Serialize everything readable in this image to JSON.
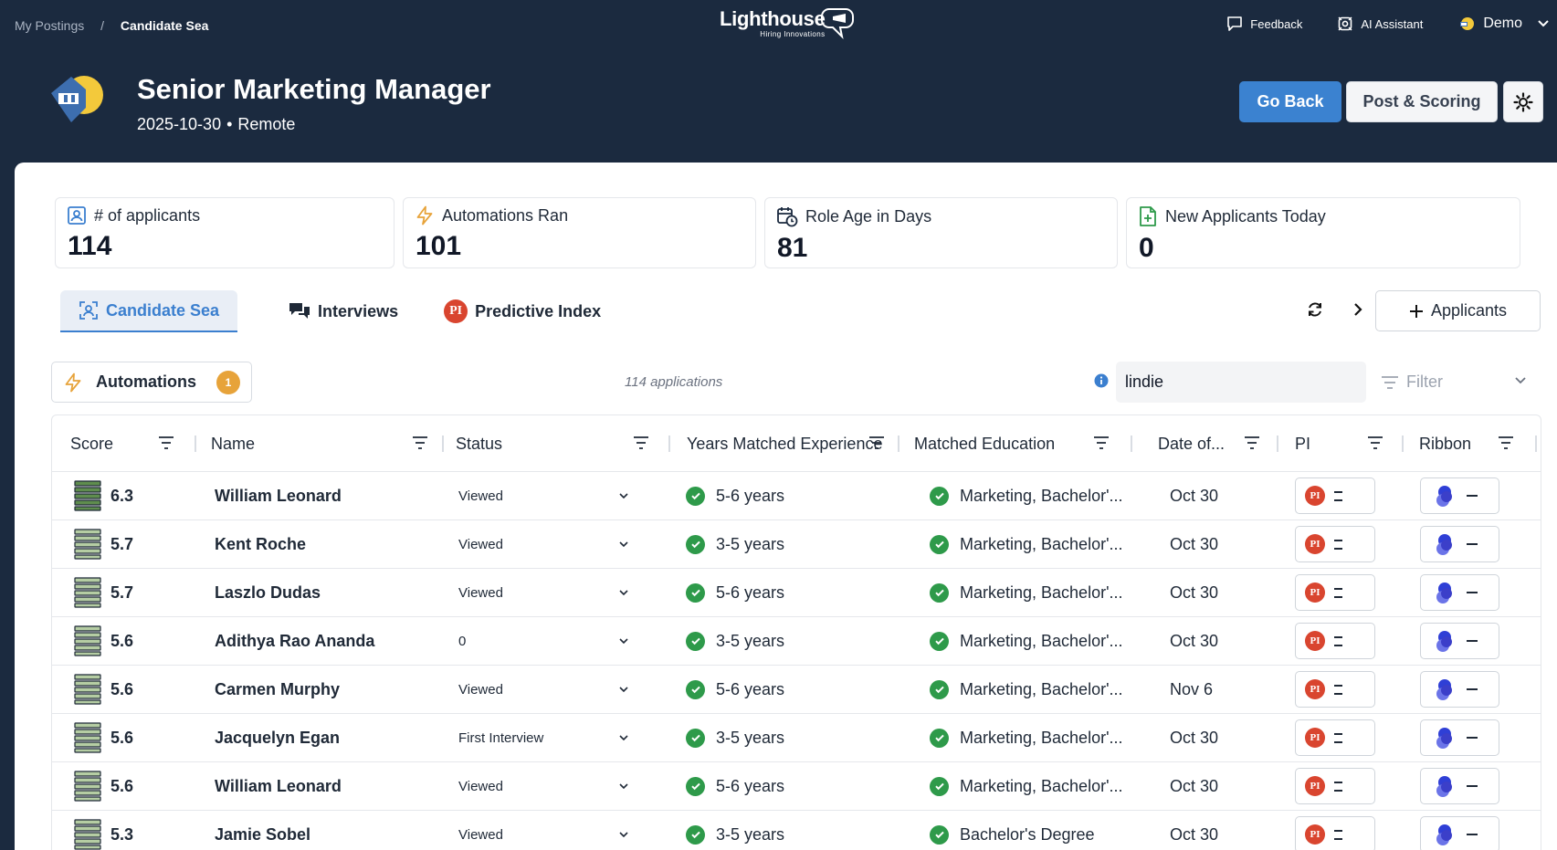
{
  "breadcrumb": {
    "root": "My Postings",
    "separator": "/",
    "current": "Candidate Sea"
  },
  "logo": {
    "word": "Lighthouse",
    "tagline": "Hiring Innovations"
  },
  "nav": {
    "feedback": "Feedback",
    "ai_assistant": "AI Assistant",
    "user": "Demo"
  },
  "job": {
    "title": "Senior Marketing Manager",
    "date": "2025-10-30",
    "location": "Remote"
  },
  "actions": {
    "go_back": "Go Back",
    "post_scoring": "Post & Scoring"
  },
  "stats": [
    {
      "label": "# of applicants",
      "value": "114",
      "icon": "user-card-icon"
    },
    {
      "label": "Automations Ran",
      "value": "101",
      "icon": "bolt-icon"
    },
    {
      "label": "Role Age in Days",
      "value": "81",
      "icon": "calendar-clock-icon"
    },
    {
      "label": "New Applicants Today",
      "value": "0",
      "icon": "file-plus-icon"
    }
  ],
  "tabs": [
    {
      "label": "Candidate Sea",
      "active": true
    },
    {
      "label": "Interviews",
      "active": false
    },
    {
      "label": "Predictive Index",
      "active": false
    }
  ],
  "add_applicants": "Applicants",
  "toolbar": {
    "automations_label": "Automations",
    "automations_badge": "1",
    "app_count": "114 applications",
    "search_value": "lindie",
    "filter_placeholder": "Filter"
  },
  "columns": [
    "Score",
    "Name",
    "Status",
    "Years Matched Experience",
    "Matched Education",
    "Date of...",
    "PI",
    "Ribbon"
  ],
  "pi_badge": "PI",
  "rows": [
    {
      "score": "6.3",
      "name": "William Leonard",
      "status": "Viewed",
      "experience": "5-6 years",
      "education": "Marketing, Bachelor'...",
      "date": "Oct 30"
    },
    {
      "score": "5.7",
      "name": "Kent Roche",
      "status": "Viewed",
      "experience": "3-5 years",
      "education": "Marketing, Bachelor'...",
      "date": "Oct 30"
    },
    {
      "score": "5.7",
      "name": "Laszlo Dudas",
      "status": "Viewed",
      "experience": "5-6 years",
      "education": "Marketing, Bachelor'...",
      "date": "Oct 30"
    },
    {
      "score": "5.6",
      "name": "Adithya Rao Ananda",
      "status": "0",
      "experience": "3-5 years",
      "education": "Marketing, Bachelor'...",
      "date": "Oct 30"
    },
    {
      "score": "5.6",
      "name": "Carmen Murphy",
      "status": "Viewed",
      "experience": "5-6 years",
      "education": "Marketing, Bachelor'...",
      "date": "Nov 6"
    },
    {
      "score": "5.6",
      "name": "Jacquelyn Egan",
      "status": "First Interview",
      "experience": "3-5 years",
      "education": "Marketing, Bachelor'...",
      "date": "Oct 30"
    },
    {
      "score": "5.6",
      "name": "William Leonard",
      "status": "Viewed",
      "experience": "5-6 years",
      "education": "Marketing, Bachelor'...",
      "date": "Oct 30"
    },
    {
      "score": "5.3",
      "name": "Jamie Sobel",
      "status": "Viewed",
      "experience": "3-5 years",
      "education": "Bachelor's Degree",
      "date": "Oct 30"
    }
  ],
  "colors": {
    "navy": "#1b2a3f",
    "accent": "#3b82d0",
    "success": "#2e9a4a",
    "badge": "#e7a33a",
    "pi": "#d9452f"
  }
}
